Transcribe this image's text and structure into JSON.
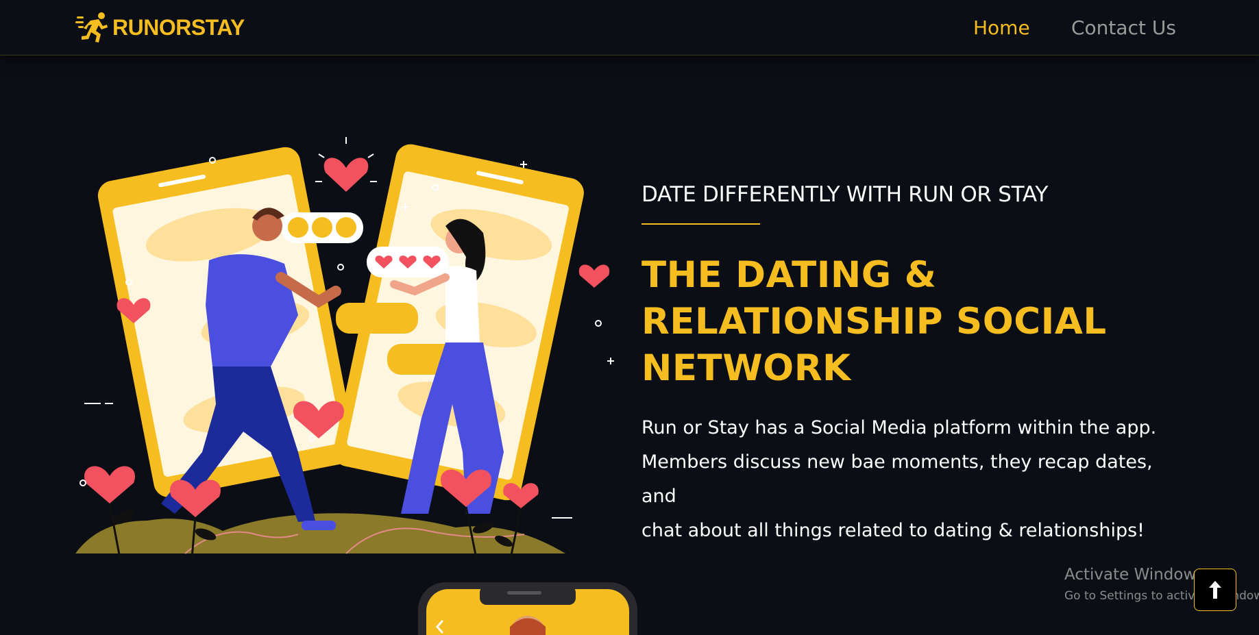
{
  "nav": {
    "brand": "RUNORSTAY",
    "links": [
      {
        "label": "Home",
        "active": true
      },
      {
        "label": "Contact Us",
        "active": false
      }
    ]
  },
  "hero": {
    "tagline": "DATE DIFFERENTLY WITH RUN OR STAY",
    "headline": [
      "THE DATING &",
      "RELATIONSHIP SOCIAL",
      "NETWORK"
    ],
    "description": [
      "Run or Stay has a Social Media platform within the app.",
      "Members discuss new bae moments, they recap dates, and",
      "chat about all things related to dating & relationships!"
    ]
  },
  "windows_watermark": {
    "title": "Activate Windows",
    "subtitle": "Go to Settings to activate Windows."
  },
  "icons": {
    "logo": "running-man-icon",
    "scroll_top": "arrow-up-icon",
    "carousel_prev": "chevron-left-icon"
  },
  "colors": {
    "accent": "#f6bd20",
    "background": "#0b0e14",
    "text": "#ffffff",
    "muted": "#9b9b9b"
  }
}
